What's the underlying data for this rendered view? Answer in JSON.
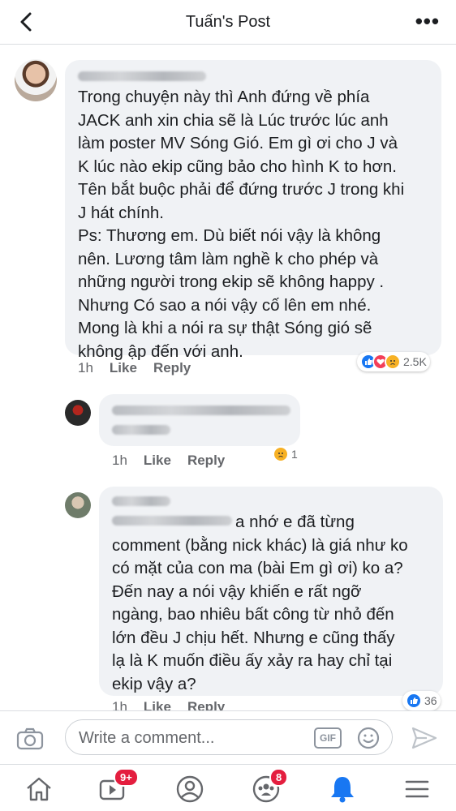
{
  "header": {
    "title": "Tuấn's Post"
  },
  "comments": [
    {
      "text": "Trong chuyện này thì Anh đứng về phía\nJACK anh xin chia sẽ là Lúc trước lúc anh\nlàm poster MV Sóng Gió. Em gì ơi  cho J và\nK lúc nào ekip cũng bảo cho hình K to hơn.\nTên bắt buộc phải để đứng trước J trong khi\nJ hát chính.\nPs: Thương em. Dù biết nói vậy là không\nnên. Lương tâm làm nghề k cho phép và\nnhững người trong ekip sẽ không happy .\nNhưng Có sao a nói vậy cố lên em nhé.\nMong là khi a nói ra sự thật Sóng gió sẽ\nkhông ập đến với anh.",
      "time": "1h",
      "like": "Like",
      "reply": "Reply",
      "reactions": {
        "count": "2.5K",
        "icons": [
          "like-icon",
          "love-icon",
          "sad-icon"
        ]
      }
    },
    {
      "time": "1h",
      "like": "Like",
      "reply": "Reply",
      "reactions": {
        "count": "1",
        "icons": [
          "sad-icon"
        ]
      }
    },
    {
      "text": "a nhớ e đã từng\ncomment (bằng nick khác) là giá như ko\ncó mặt của con ma (bài Em gì ơi) ko a?\nĐến nay a nói vậy khiến e rất ngỡ\nngàng, bao nhiêu bất công từ nhỏ đến\nlớn đều J chịu hết. Nhưng e cũng thấy\nlạ là K muốn điều ấy xảy ra hay chỉ tại\nekip vậy a?",
      "time": "1h",
      "like": "Like",
      "reply": "Reply",
      "reactions": {
        "count": "36",
        "icons": [
          "like-icon"
        ]
      }
    }
  ],
  "composer": {
    "placeholder": "Write a comment...",
    "gif_label": "GIF"
  },
  "tabs": {
    "watch_badge": "9+",
    "groups_badge": "8"
  },
  "colors": {
    "accent": "#1877f2",
    "badge": "#e41e3f"
  }
}
